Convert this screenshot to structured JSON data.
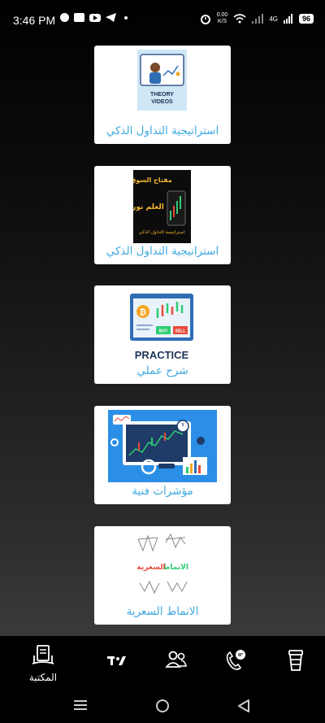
{
  "status_bar": {
    "time": "3:46 PM",
    "network_speed": "0.00\nK/S",
    "network_type": "4G",
    "battery": "96"
  },
  "cards": [
    {
      "caption": "استراتيجية التداول الذكي",
      "thumb_text": "THEORY\nVIDEOS"
    },
    {
      "caption": "استراتيجية التداول الذكي",
      "thumb_title": "مفتاح السوق",
      "thumb_sub": "العلم نور",
      "thumb_footer": "استراتيجية التداول الذكي"
    },
    {
      "caption": "شرح عملي",
      "thumb_text": "PRACTICE",
      "buy_label": "BUY",
      "sell_label": "SELL"
    },
    {
      "caption": "مؤشرات فنية"
    },
    {
      "caption": "الانماط السعرية",
      "thumb_text_green": "الانماط",
      "thumb_text_red": "السعرية"
    }
  ],
  "bottom_nav": {
    "items": [
      {
        "label": "المكتبة",
        "icon": "library-icon",
        "active": true
      },
      {
        "label": "",
        "icon": "tradingview-icon"
      },
      {
        "label": "",
        "icon": "users-icon"
      },
      {
        "label": "",
        "icon": "support-call-icon"
      },
      {
        "label": "",
        "icon": "coffee-cup-icon"
      }
    ]
  },
  "colors": {
    "caption": "#3fa9e0",
    "card_bg": "#ffffff",
    "nav_bg": "#000000"
  }
}
